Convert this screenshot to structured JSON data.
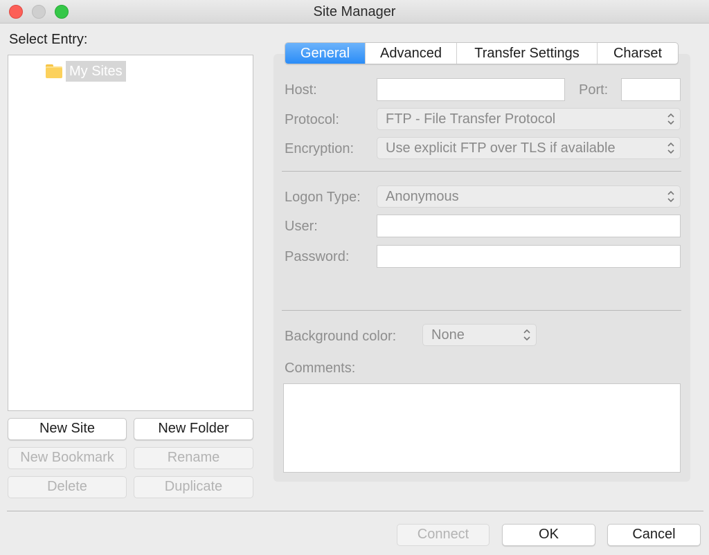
{
  "window": {
    "title": "Site Manager"
  },
  "left": {
    "select_label": "Select Entry:",
    "tree": {
      "root_label": "My Sites"
    },
    "buttons": {
      "new_site": "New Site",
      "new_folder": "New Folder",
      "new_bookmark": "New Bookmark",
      "rename": "Rename",
      "delete": "Delete",
      "duplicate": "Duplicate"
    }
  },
  "tabs": [
    "General",
    "Advanced",
    "Transfer Settings",
    "Charset"
  ],
  "general": {
    "host_label": "Host:",
    "host_value": "",
    "port_label": "Port:",
    "port_value": "",
    "protocol_label": "Protocol:",
    "protocol_value": "FTP - File Transfer Protocol",
    "encryption_label": "Encryption:",
    "encryption_value": "Use explicit FTP over TLS if available",
    "logon_type_label": "Logon Type:",
    "logon_type_value": "Anonymous",
    "user_label": "User:",
    "user_value": "",
    "password_label": "Password:",
    "password_value": "",
    "background_color_label": "Background color:",
    "background_color_value": "None",
    "comments_label": "Comments:",
    "comments_value": ""
  },
  "footer": {
    "connect": "Connect",
    "ok": "OK",
    "cancel": "Cancel"
  },
  "colors": {
    "accent": "#2a8cf7",
    "folder": "#fcd15c",
    "close": "#fc5f57",
    "maximize": "#35c748"
  }
}
